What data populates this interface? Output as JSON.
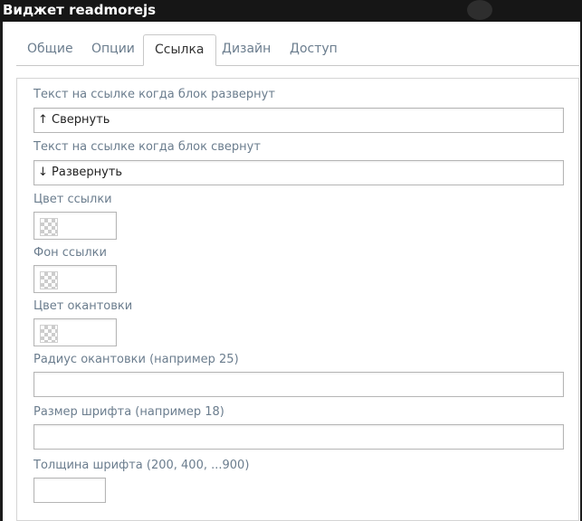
{
  "window": {
    "title": "Виджет readmorejs"
  },
  "tabs": [
    {
      "label": "Общие"
    },
    {
      "label": "Опции"
    },
    {
      "label": "Ссылка",
      "active": true
    },
    {
      "label": "Дизайн"
    },
    {
      "label": "Доступ"
    }
  ],
  "form": {
    "expanded_label": "Текст на ссылке когда блок развернут",
    "expanded_value": "↑ Свернуть",
    "collapsed_label": "Текст на ссылке когда блок свернут",
    "collapsed_value": "↓ Развернуть",
    "link_color_label": "Цвет ссылки",
    "link_bg_label": "Фон ссылки",
    "border_color_label": "Цвет окантовки",
    "border_radius_label": "Радиус окантовки (например 25)",
    "border_radius_value": "",
    "font_size_label": "Размер шрифта (например 18)",
    "font_size_value": "",
    "font_weight_label": "Толщина шрифта (200, 400, ...900)",
    "font_weight_value": ""
  },
  "colors": {
    "label": "#6b7d8e",
    "border": "#b5b5b5",
    "titlebar": "#161616"
  }
}
